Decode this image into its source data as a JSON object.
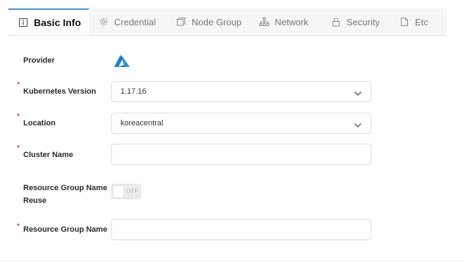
{
  "tabs": [
    {
      "label": "Basic Info",
      "icon": "info-icon",
      "active": true
    },
    {
      "label": "Credential",
      "icon": "gear-icon",
      "active": false
    },
    {
      "label": "Node Group",
      "icon": "node-group-icon",
      "active": false
    },
    {
      "label": "Network",
      "icon": "network-icon",
      "active": false
    },
    {
      "label": "Security",
      "icon": "lock-icon",
      "active": false
    },
    {
      "label": "Etc",
      "icon": "document-icon",
      "active": false
    }
  ],
  "form": {
    "provider_label": "Provider",
    "provider_logo": "azure-logo",
    "kubernetes_version": {
      "label": "Kubernetes Version",
      "value": "1.17.16",
      "required": true
    },
    "location": {
      "label": "Location",
      "value": "koreacentral",
      "required": true
    },
    "cluster_name": {
      "label": "Cluster Name",
      "value": "",
      "required": true
    },
    "resource_group_name_reuse": {
      "label_line1": "Resource Group Name",
      "label_line2": "Reuse",
      "toggle_text": "OFF",
      "on": false
    },
    "resource_group_name": {
      "label": "Resource Group Name",
      "value": "",
      "required": true
    },
    "required_marker": "*"
  },
  "colors": {
    "accent": "#3d8fe0",
    "azure": "#1a7fd6",
    "required": "#e23a3a"
  }
}
